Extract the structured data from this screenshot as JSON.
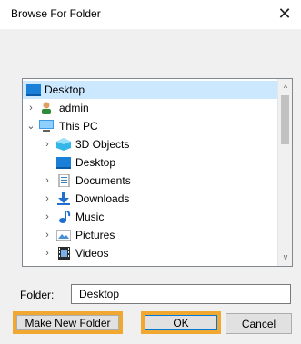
{
  "window": {
    "title": "Browse For Folder",
    "close_glyph": "✕"
  },
  "tree": {
    "items": [
      {
        "label": "Desktop",
        "icon": "desktop-icon",
        "chevron": "",
        "selected": true
      },
      {
        "label": "admin",
        "icon": "user-icon",
        "chevron": "›"
      },
      {
        "label": "This PC",
        "icon": "pc-icon",
        "chevron": "⌄"
      },
      {
        "label": "3D Objects",
        "icon": "3d-objects-icon",
        "chevron": "›"
      },
      {
        "label": "Desktop",
        "icon": "desktop-icon",
        "chevron": ""
      },
      {
        "label": "Documents",
        "icon": "documents-icon",
        "chevron": "›"
      },
      {
        "label": "Downloads",
        "icon": "downloads-icon",
        "chevron": "›"
      },
      {
        "label": "Music",
        "icon": "music-icon",
        "chevron": "›"
      },
      {
        "label": "Pictures",
        "icon": "pictures-icon",
        "chevron": "›"
      },
      {
        "label": "Videos",
        "icon": "videos-icon",
        "chevron": "›"
      }
    ],
    "scroll_up": "^",
    "scroll_down": "v"
  },
  "folder": {
    "label": "Folder:",
    "value": "Desktop"
  },
  "buttons": {
    "make_new_folder": "Make New Folder",
    "ok": "OK",
    "cancel": "Cancel"
  },
  "colors": {
    "selection": "#cce8ff",
    "highlight": "#f0a830",
    "accent": "#0078d7"
  }
}
